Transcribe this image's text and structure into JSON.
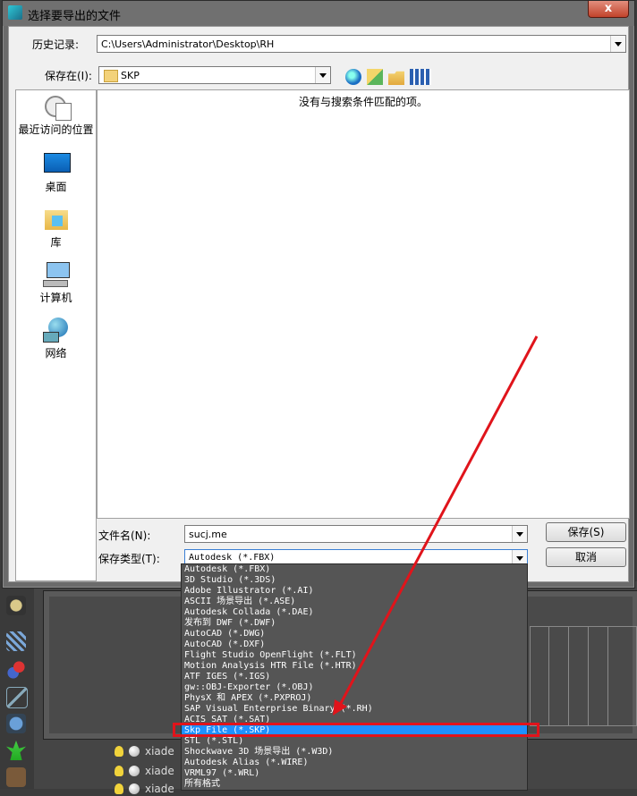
{
  "dialog": {
    "title": "选择要导出的文件",
    "close_label": "x",
    "history_label": "历史记录:",
    "history_path": "C:\\Users\\Administrator\\Desktop\\RH",
    "save_in_label": "保存在(I):",
    "save_in_value": "SKP",
    "empty_message": "没有与搜索条件匹配的项。",
    "filename_label": "文件名(N):",
    "filename_value": "sucj.me",
    "filetype_label": "保存类型(T):",
    "filetype_value": "Autodesk (*.FBX)",
    "save_button": "保存(S)",
    "cancel_button": "取消"
  },
  "places": [
    {
      "label": "最近访问的位置",
      "icon": "recent-places-icon"
    },
    {
      "label": "桌面",
      "icon": "desktop-icon"
    },
    {
      "label": "库",
      "icon": "library-icon"
    },
    {
      "label": "计算机",
      "icon": "computer-icon"
    },
    {
      "label": "网络",
      "icon": "network-icon"
    }
  ],
  "toolbar_icons": [
    "back-icon",
    "up-folder-icon",
    "new-folder-icon",
    "view-menu-icon"
  ],
  "filetype_options": [
    "Autodesk (*.FBX)",
    "3D Studio (*.3DS)",
    "Adobe Illustrator (*.AI)",
    "ASCII 场景导出 (*.ASE)",
    "Autodesk Collada (*.DAE)",
    "发布到 DWF (*.DWF)",
    "AutoCAD (*.DWG)",
    "AutoCAD (*.DXF)",
    "Flight Studio OpenFlight (*.FLT)",
    "Motion Analysis HTR File (*.HTR)",
    "ATF IGES (*.IGS)",
    "gw::OBJ-Exporter (*.OBJ)",
    "PhysX 和 APEX (*.PXPROJ)",
    "SAP Visual Enterprise Binary (*.RH)",
    "ACIS SAT (*.SAT)",
    "Skp File (*.SKP)",
    "STL (*.STL)",
    "Shockwave 3D 场景导出 (*.W3D)",
    "Autodesk Alias (*.WIRE)",
    "VRML97 (*.WRL)",
    "所有格式"
  ],
  "selected_option": "Skp File (*.SKP)",
  "background": {
    "layer_items": [
      "xiade",
      "xiade",
      "xiade"
    ]
  },
  "colors": {
    "annotation": "#e0141b",
    "selection": "#1e90ff"
  }
}
